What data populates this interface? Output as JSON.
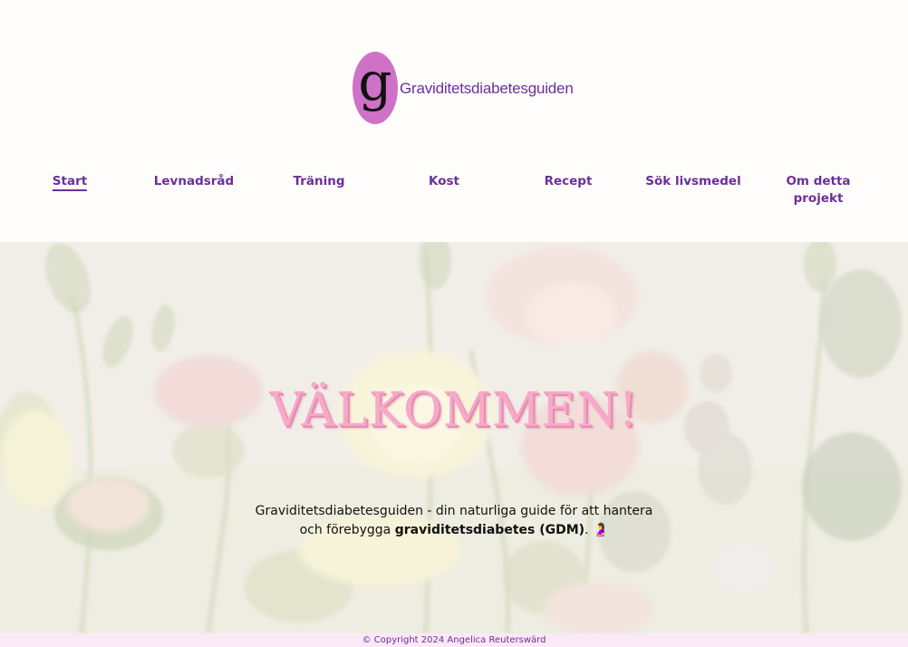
{
  "site": {
    "logo_letter": "g",
    "logo_text": "Graviditetsdiabetesguiden"
  },
  "nav": {
    "items": [
      {
        "label": "Start"
      },
      {
        "label": "Levnadsråd"
      },
      {
        "label": "Träning"
      },
      {
        "label": "Kost"
      },
      {
        "label": "Recept"
      },
      {
        "label": "Sök livsmedel"
      },
      {
        "label": "Om detta projekt"
      }
    ],
    "active_index": 0
  },
  "hero": {
    "title": "VÄLKOMMEN!",
    "text_line1": "Graviditetsdiabetesguiden - din naturliga guide för att hantera",
    "text_line2_prefix": "och förebygga ",
    "text_line2_bold": "graviditetsdiabetes (GDM)",
    "text_line2_suffix": ".",
    "emoji": "🤰"
  },
  "footer": {
    "copyright": "© Copyright 2024 Angelica Reuterswärd"
  },
  "colors": {
    "brand_purple": "#6b2f9a",
    "logo_pink": "#cf72c7",
    "title_pink": "#f7a9c8",
    "footer_bg": "#fbe9f6"
  }
}
